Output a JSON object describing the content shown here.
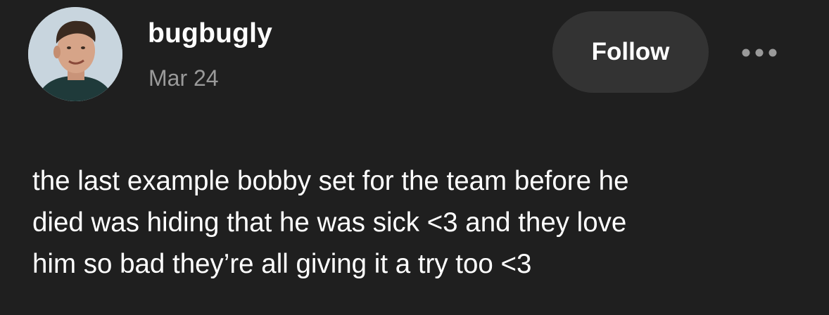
{
  "post": {
    "username": "bugbugly",
    "date": "Mar 24",
    "follow_label": "Follow",
    "more_icon": "more-horizontal-icon",
    "body_text": "the last example bobby set for the team before he\ndied was hiding that he was sick <3 and they love\nhim so bad they’re all giving it a try too <3"
  },
  "colors": {
    "background": "#1f1f1f",
    "follow_button": "#333333",
    "date_text": "#9a9a9a",
    "text": "#ffffff"
  }
}
